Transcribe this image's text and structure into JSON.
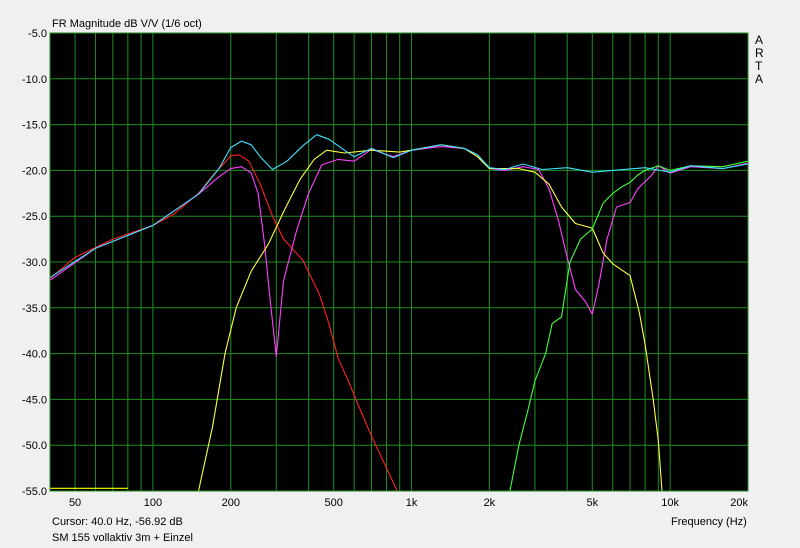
{
  "window": {
    "title": "FR Magnitude dB V/V (1/6 oct)",
    "cursor_readout": "Cursor: 40.0 Hz, -56.92 dB",
    "status": "SM 155 vollaktiv 3m + Einzel",
    "brand_letters": [
      "A",
      "R",
      "T",
      "A"
    ]
  },
  "chart_data": {
    "type": "line",
    "title": "FR Magnitude dB V/V (1/6 oct)",
    "xlabel": "Frequency (Hz)",
    "ylabel": "",
    "x_scale": "log",
    "xlim": [
      40,
      20000
    ],
    "ylim": [
      -55,
      -5
    ],
    "grid": true,
    "background": "#000000",
    "grid_color": "#1f8f1f",
    "y_ticks": [
      -5,
      -10,
      -15,
      -20,
      -25,
      -30,
      -35,
      -40,
      -45,
      -50,
      -55
    ],
    "y_tick_labels": [
      "-5.0",
      "-10.0",
      "-15.0",
      "-20.0",
      "-25.0",
      "-30.0",
      "-35.0",
      "-40.0",
      "-45.0",
      "-50.0",
      "-55.0"
    ],
    "x_tick_labels": [
      {
        "value": 50,
        "label": "50"
      },
      {
        "value": 100,
        "label": "100"
      },
      {
        "value": 200,
        "label": "200"
      },
      {
        "value": 500,
        "label": "500"
      },
      {
        "value": 1000,
        "label": "1k"
      },
      {
        "value": 2000,
        "label": "2k"
      },
      {
        "value": 5000,
        "label": "5k"
      },
      {
        "value": 10000,
        "label": "10k"
      },
      {
        "value": 20000,
        "label": "20k"
      }
    ],
    "minor_x_grid": [
      60,
      70,
      80,
      90,
      300,
      400,
      600,
      700,
      800,
      900,
      3000,
      4000,
      6000,
      7000,
      8000,
      9000
    ],
    "series": [
      {
        "color": "#ff2020",
        "points": [
          [
            40,
            -31.8
          ],
          [
            50,
            -29.5
          ],
          [
            70,
            -27.5
          ],
          [
            100,
            -26
          ],
          [
            120,
            -24.8
          ],
          [
            150,
            -22.5
          ],
          [
            170,
            -20.6
          ],
          [
            200,
            -18.4
          ],
          [
            215,
            -18.3
          ],
          [
            235,
            -19
          ],
          [
            260,
            -21.5
          ],
          [
            290,
            -25
          ],
          [
            320,
            -27.5
          ],
          [
            380,
            -29.8
          ],
          [
            440,
            -33.5
          ],
          [
            480,
            -36.8
          ],
          [
            520,
            -40.5
          ],
          [
            570,
            -43
          ],
          [
            620,
            -45.5
          ],
          [
            700,
            -49
          ],
          [
            800,
            -52.5
          ],
          [
            880,
            -55
          ]
        ]
      },
      {
        "color": "#ff40ff",
        "points": [
          [
            40,
            -32
          ],
          [
            60,
            -28.5
          ],
          [
            100,
            -26
          ],
          [
            150,
            -22.6
          ],
          [
            180,
            -20.7
          ],
          [
            200,
            -19.8
          ],
          [
            220,
            -19.6
          ],
          [
            240,
            -20.3
          ],
          [
            255,
            -22.5
          ],
          [
            270,
            -28
          ],
          [
            285,
            -34.5
          ],
          [
            300,
            -40.3
          ],
          [
            320,
            -32
          ],
          [
            360,
            -26.5
          ],
          [
            400,
            -22.5
          ],
          [
            450,
            -19.4
          ],
          [
            520,
            -18.8
          ],
          [
            600,
            -19
          ],
          [
            700,
            -17.7
          ],
          [
            850,
            -18.5
          ],
          [
            1000,
            -17.8
          ],
          [
            1300,
            -17.4
          ],
          [
            1600,
            -17.6
          ],
          [
            1800,
            -18.3
          ],
          [
            2000,
            -19.8
          ],
          [
            2300,
            -20
          ],
          [
            2700,
            -19.6
          ],
          [
            3100,
            -19.9
          ],
          [
            3400,
            -22
          ],
          [
            3700,
            -25.5
          ],
          [
            4000,
            -29.5
          ],
          [
            4300,
            -33
          ],
          [
            4700,
            -34.3
          ],
          [
            5000,
            -35.7
          ],
          [
            5300,
            -32.5
          ],
          [
            5700,
            -27.5
          ],
          [
            6200,
            -24
          ],
          [
            7000,
            -23.5
          ],
          [
            7500,
            -22
          ],
          [
            8500,
            -20.5
          ],
          [
            9000,
            -19.5
          ],
          [
            10000,
            -20.3
          ],
          [
            12000,
            -19.6
          ],
          [
            16000,
            -19.8
          ],
          [
            20000,
            -19.2
          ]
        ]
      },
      {
        "color": "#ffff40",
        "points": [
          [
            150,
            -55
          ],
          [
            170,
            -48
          ],
          [
            190,
            -40
          ],
          [
            210,
            -35
          ],
          [
            240,
            -31
          ],
          [
            280,
            -28
          ],
          [
            320,
            -24.5
          ],
          [
            370,
            -21
          ],
          [
            420,
            -18.8
          ],
          [
            470,
            -17.8
          ],
          [
            550,
            -18.1
          ],
          [
            700,
            -17.8
          ],
          [
            900,
            -18
          ],
          [
            1000,
            -17.8
          ],
          [
            1300,
            -17.2
          ],
          [
            1600,
            -17.6
          ],
          [
            1800,
            -18.5
          ],
          [
            2000,
            -19.8
          ],
          [
            2600,
            -19.8
          ],
          [
            3000,
            -20.2
          ],
          [
            3400,
            -21.5
          ],
          [
            3800,
            -24
          ],
          [
            4300,
            -25.8
          ],
          [
            5000,
            -26.3
          ],
          [
            5500,
            -29
          ],
          [
            6000,
            -30.2
          ],
          [
            7000,
            -31.5
          ],
          [
            7600,
            -35.5
          ],
          [
            8000,
            -39
          ],
          [
            8600,
            -45
          ],
          [
            9000,
            -49.5
          ],
          [
            9300,
            -55
          ]
        ]
      },
      {
        "color": "#40ff40",
        "points": [
          [
            2400,
            -55
          ],
          [
            2600,
            -50
          ],
          [
            2800,
            -46.5
          ],
          [
            3000,
            -43
          ],
          [
            3300,
            -40
          ],
          [
            3500,
            -36.7
          ],
          [
            3800,
            -36
          ],
          [
            4100,
            -30
          ],
          [
            4500,
            -27.5
          ],
          [
            5000,
            -26.4
          ],
          [
            5500,
            -23.6
          ],
          [
            6000,
            -22.5
          ],
          [
            6500,
            -21.8
          ],
          [
            7000,
            -21.3
          ],
          [
            7500,
            -20.5
          ],
          [
            8000,
            -20
          ],
          [
            9000,
            -19.5
          ],
          [
            10000,
            -20
          ],
          [
            12000,
            -19.5
          ],
          [
            16000,
            -19.6
          ],
          [
            20000,
            -19
          ]
        ]
      },
      {
        "color": "#40e0ff",
        "points": [
          [
            40,
            -31.7
          ],
          [
            60,
            -28.5
          ],
          [
            100,
            -26
          ],
          [
            150,
            -22.6
          ],
          [
            180,
            -19.8
          ],
          [
            200,
            -17.5
          ],
          [
            220,
            -16.8
          ],
          [
            240,
            -17.2
          ],
          [
            260,
            -18.5
          ],
          [
            290,
            -19.9
          ],
          [
            330,
            -19
          ],
          [
            380,
            -17.3
          ],
          [
            430,
            -16.1
          ],
          [
            480,
            -16.6
          ],
          [
            550,
            -17.8
          ],
          [
            600,
            -18.5
          ],
          [
            700,
            -17.6
          ],
          [
            850,
            -18.6
          ],
          [
            1000,
            -17.8
          ],
          [
            1300,
            -17.2
          ],
          [
            1600,
            -17.6
          ],
          [
            1800,
            -18.3
          ],
          [
            2000,
            -19.7
          ],
          [
            2300,
            -19.9
          ],
          [
            2700,
            -19.3
          ],
          [
            3200,
            -19.9
          ],
          [
            4000,
            -19.7
          ],
          [
            5000,
            -20.2
          ],
          [
            6000,
            -20
          ],
          [
            8000,
            -19.7
          ],
          [
            10000,
            -20.2
          ],
          [
            12000,
            -19.5
          ],
          [
            16000,
            -19.8
          ],
          [
            20000,
            -19.3
          ]
        ]
      },
      {
        "color": "#ffff00",
        "points": [
          [
            40,
            -54.7
          ],
          [
            80,
            -54.7
          ]
        ]
      }
    ]
  }
}
